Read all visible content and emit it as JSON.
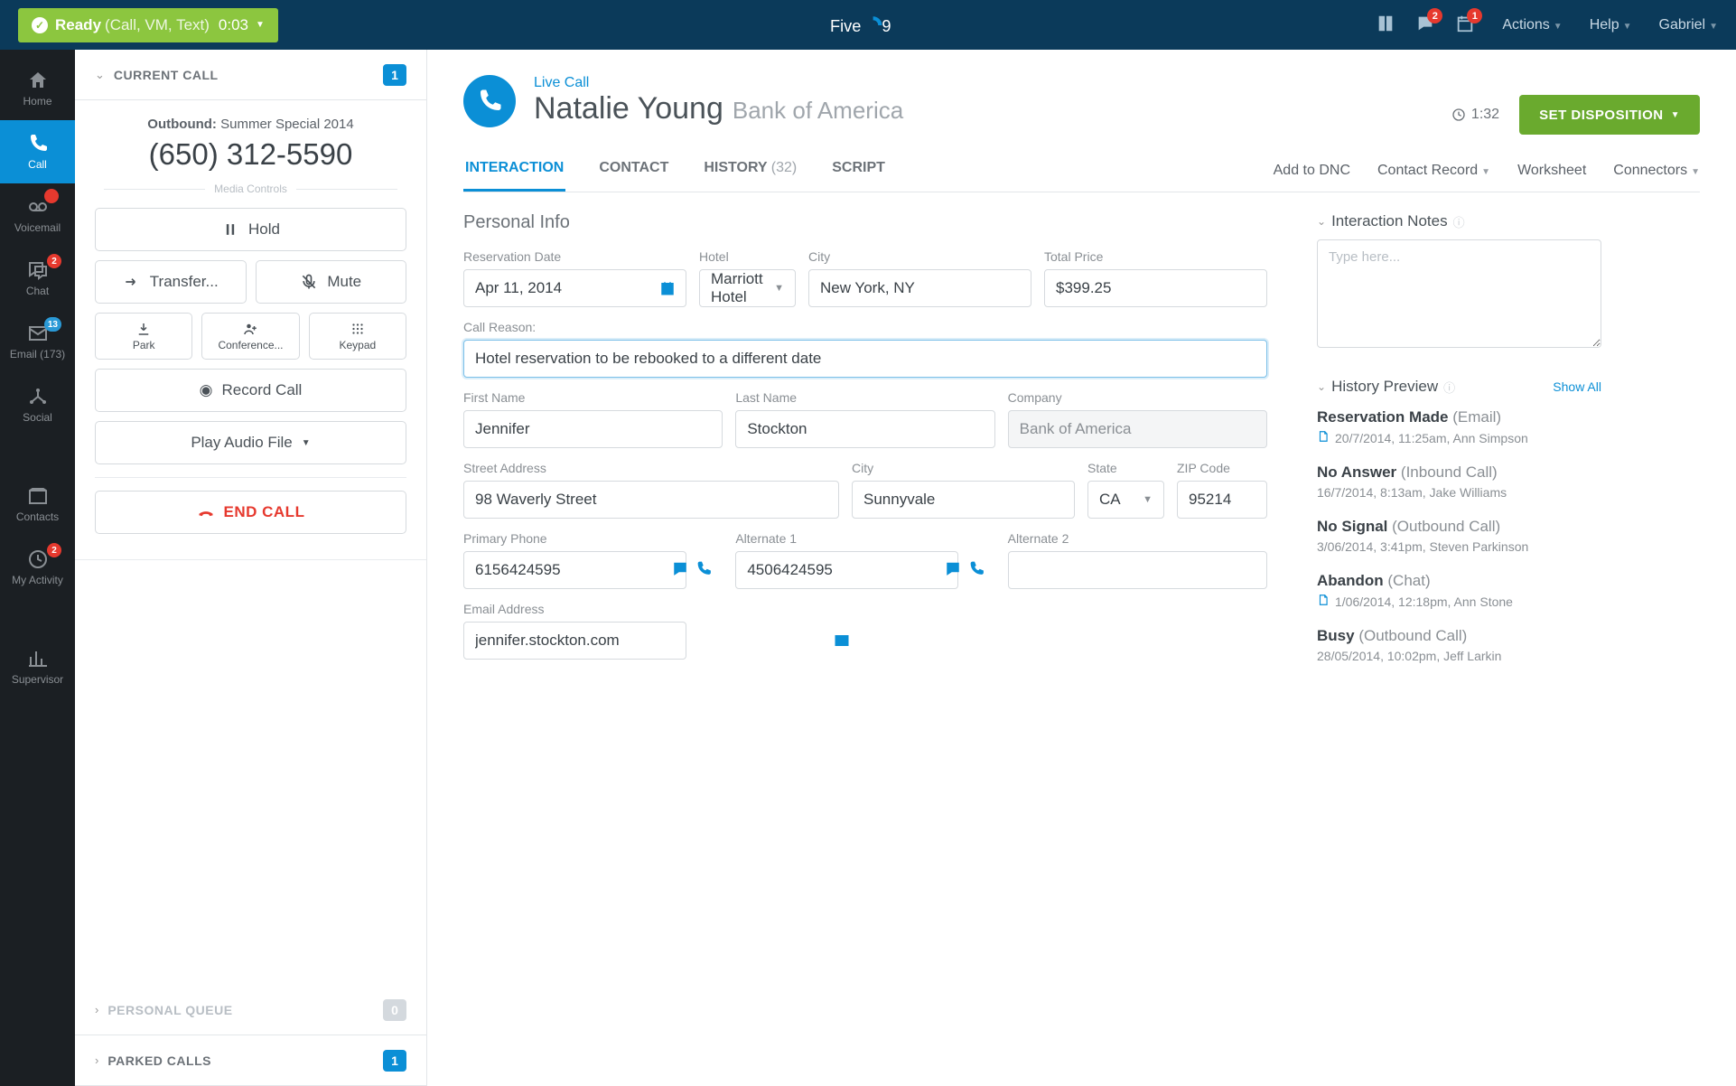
{
  "topbar": {
    "status_ready": "Ready",
    "status_modes": "(Call, VM, Text)",
    "status_timer": "0:03",
    "brand": "Five9",
    "notif_chat_badge": "2",
    "notif_cal_badge": "1",
    "actions": "Actions",
    "help": "Help",
    "user": "Gabriel"
  },
  "rail": {
    "home": "Home",
    "call": "Call",
    "voicemail": "Voicemail",
    "chat": "Chat",
    "chat_badge": "2",
    "email": "Email (173)",
    "email_badge": "13",
    "social": "Social",
    "contacts": "Contacts",
    "activity": "My Activity",
    "activity_badge": "2",
    "supervisor": "Supervisor"
  },
  "leftpanel": {
    "current_call": "CURRENT CALL",
    "current_call_count": "1",
    "outbound_label": "Outbound:",
    "outbound_campaign": "Summer Special 2014",
    "phone": "(650) 312-5590",
    "media_controls": "Media Controls",
    "hold": "Hold",
    "transfer": "Transfer...",
    "mute": "Mute",
    "park": "Park",
    "conference": "Conference...",
    "keypad": "Keypad",
    "record": "Record Call",
    "play_audio": "Play Audio File",
    "end_call": "END CALL",
    "personal_queue": "PERSONAL QUEUE",
    "personal_queue_count": "0",
    "parked_calls": "PARKED CALLS",
    "parked_calls_count": "1"
  },
  "mainhead": {
    "live": "Live Call",
    "name": "Natalie Young",
    "company": "Bank of America",
    "timer": "1:32",
    "set_disposition": "SET DISPOSITION"
  },
  "tabs": {
    "interaction": "INTERACTION",
    "contact": "CONTACT",
    "history": "HISTORY",
    "history_count": "(32)",
    "script": "SCRIPT",
    "add_dnc": "Add to DNC",
    "contact_record": "Contact Record",
    "worksheet": "Worksheet",
    "connectors": "Connectors"
  },
  "form": {
    "section_personal": "Personal Info",
    "reservation_date_label": "Reservation Date",
    "reservation_date": "Apr 11, 2014",
    "hotel_label": "Hotel",
    "hotel": "Marriott Hotel",
    "city1_label": "City",
    "city1": "New York, NY",
    "total_price_label": "Total Price",
    "total_price": "$399.25",
    "call_reason_label": "Call Reason:",
    "call_reason": "Hotel reservation to be rebooked to a different date",
    "first_name_label": "First Name",
    "first_name": "Jennifer",
    "last_name_label": "Last Name",
    "last_name": "Stockton",
    "company_label": "Company",
    "company": "Bank of America",
    "street_label": "Street Address",
    "street": "98 Waverly Street",
    "city2_label": "City",
    "city2": "Sunnyvale",
    "state_label": "State",
    "state": "CA",
    "zip_label": "ZIP Code",
    "zip": "95214",
    "primary_phone_label": "Primary Phone",
    "primary_phone": "6156424595",
    "alt1_label": "Alternate 1",
    "alt1": "4506424595",
    "alt2_label": "Alternate 2",
    "alt2": "",
    "email_label": "Email Address",
    "email": "jennifer.stockton.com"
  },
  "side": {
    "notes_title": "Interaction Notes",
    "notes_placeholder": "Type here...",
    "history_title": "History Preview",
    "show_all": "Show All",
    "items": [
      {
        "title": "Reservation Made",
        "type": "(Email)",
        "meta": "20/7/2014, 11:25am, Ann Simpson",
        "icon": true
      },
      {
        "title": "No Answer",
        "type": "(Inbound Call)",
        "meta": "16/7/2014, 8:13am, Jake Williams",
        "icon": false
      },
      {
        "title": "No Signal",
        "type": "(Outbound Call)",
        "meta": "3/06/2014, 3:41pm, Steven Parkinson",
        "icon": false
      },
      {
        "title": "Abandon",
        "type": "(Chat)",
        "meta": "1/06/2014, 12:18pm, Ann Stone",
        "icon": true
      },
      {
        "title": "Busy",
        "type": "(Outbound Call)",
        "meta": "28/05/2014, 10:02pm, Jeff Larkin",
        "icon": false
      }
    ]
  }
}
